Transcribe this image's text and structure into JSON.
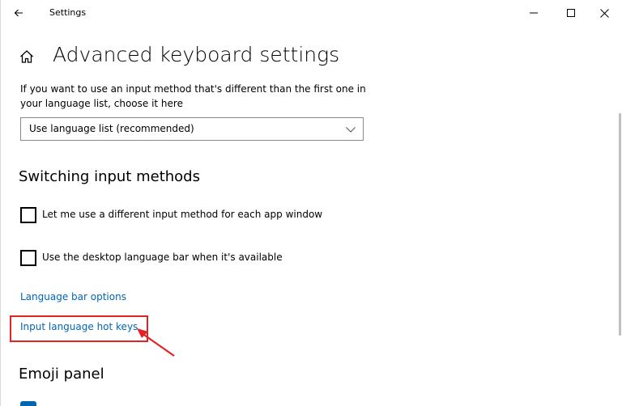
{
  "window": {
    "title": "Settings"
  },
  "header": {
    "title": "Advanced keyboard settings"
  },
  "override": {
    "description": "If you want to use an input method that's different than the first one in your language list, choose it here",
    "dropdown_value": "Use language list (recommended)"
  },
  "switching": {
    "heading": "Switching input methods",
    "checkboxes": [
      {
        "label": "Let me use a different input method for each app window",
        "checked": false
      },
      {
        "label": "Use the desktop language bar when it's available",
        "checked": false
      }
    ],
    "links": {
      "language_bar_options": "Language bar options",
      "input_language_hot_keys": "Input language hot keys"
    }
  },
  "emoji": {
    "heading": "Emoji panel"
  },
  "annotation": {
    "highlight_color": "#e32222"
  },
  "colors": {
    "link": "#0066b4",
    "accent": "#0066b4"
  },
  "icons": {
    "back": "back-arrow-icon",
    "home": "home-icon",
    "minimize": "minimize-icon",
    "maximize": "maximize-icon",
    "close": "close-icon",
    "dropdown": "chevron-down-icon"
  }
}
